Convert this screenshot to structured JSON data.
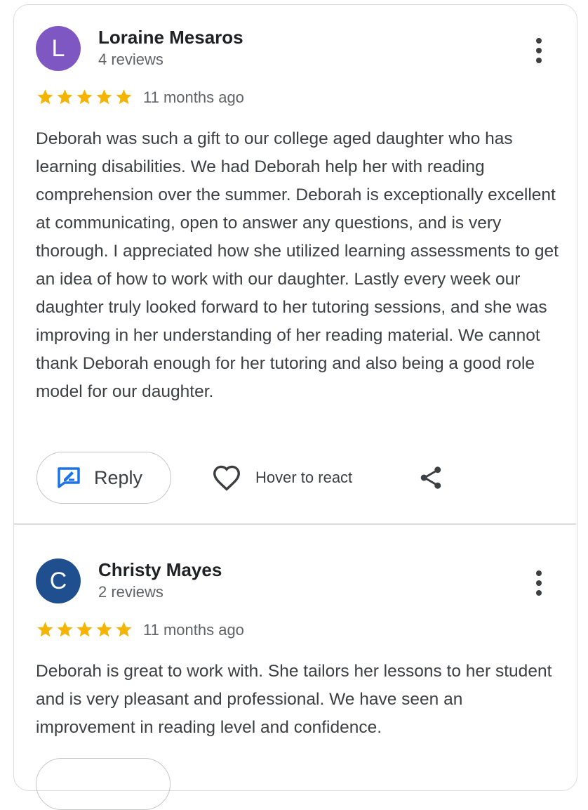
{
  "reviews": [
    {
      "avatar_letter": "L",
      "avatar_color": "#7e57c2",
      "name": "Loraine Mesaros",
      "review_count": "4 reviews",
      "rating": 5,
      "date": "11 months ago",
      "text": "Deborah was such a gift to our college aged daughter who has learning disabilities. We had Deborah help her with reading comprehension over the summer. Deborah is exceptionally excellent at communicating, open to answer any questions, and is very thorough. I appreciated how she utilized learning assessments to get an idea of how to work with our daughter. Lastly every week our daughter truly looked forward to her tutoring sessions, and she was improving in her understanding of her reading material. We cannot thank Deborah enough for her tutoring and also being a good role model for our daughter.",
      "reply_label": "Reply",
      "react_label": "Hover to react"
    },
    {
      "avatar_letter": "C",
      "avatar_color": "#1f4f8f",
      "name": "Christy Mayes",
      "review_count": "2 reviews",
      "rating": 5,
      "date": "11 months ago",
      "text": "Deborah is great to work with. She tailors her lessons to her student and is very pleasant and professional. We have seen an improvement in reading level and confidence."
    }
  ],
  "colors": {
    "star": "#f4b400",
    "reply_icon": "#1a73e8",
    "icon": "#3c4043"
  }
}
